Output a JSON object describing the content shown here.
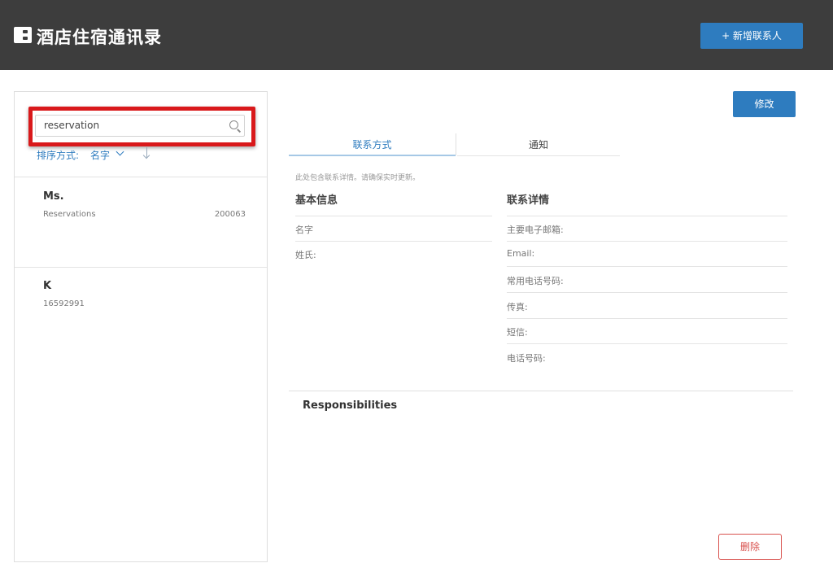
{
  "header": {
    "logo_icon": "b-logo-icon",
    "title": "酒店住宿通讯录",
    "new_contact_button": "+ 新增联系人"
  },
  "sidebar": {
    "search": {
      "value": "reservation",
      "icon": "search-icon"
    },
    "sort": {
      "label": "排序方式:",
      "value": "名字",
      "direction_icon": "arrow-down-icon"
    },
    "contacts": [
      {
        "name": "Ms.",
        "subtitle": "Reservations",
        "number": "200063"
      },
      {
        "name": "K",
        "subtitle": "16592991",
        "number": ""
      }
    ]
  },
  "detail": {
    "edit_button": "修改",
    "tabs": [
      {
        "label": "联系方式",
        "active": true
      },
      {
        "label": "通知",
        "active": false
      }
    ],
    "notice": "此处包含联系详情。请确保实时更新。",
    "basic_info": {
      "title": "基本信息",
      "fields": [
        "名字",
        "姓氏:"
      ]
    },
    "contact_details": {
      "title": "联系详情",
      "fields": [
        "主要电子邮箱:",
        "Email:",
        "常用电话号码:",
        "传真:",
        "短信:",
        "电话号码:"
      ]
    },
    "responsibilities_title": "Responsibilities",
    "delete_button": "删除"
  },
  "colors": {
    "header_bg": "#3d3d3d",
    "accent": "#2e7cbf",
    "highlight": "#d9191b",
    "danger": "#d9534f"
  }
}
